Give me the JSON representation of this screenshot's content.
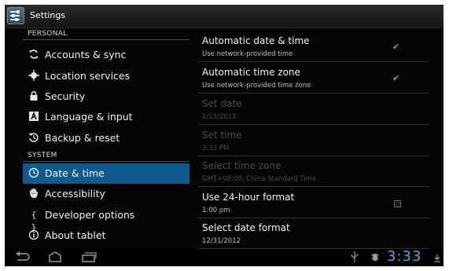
{
  "app": {
    "title": "Settings",
    "accent": "#33b5e5",
    "selected_bg": "#0f5b8f"
  },
  "left": {
    "personal_header": "PERSONAL",
    "system_header": "SYSTEM",
    "items": [
      {
        "label": "Accounts & sync",
        "icon": "sync-icon"
      },
      {
        "label": "Location services",
        "icon": "location-icon"
      },
      {
        "label": "Security",
        "icon": "lock-icon"
      },
      {
        "label": "Language & input",
        "icon": "keyboard-a-icon"
      },
      {
        "label": "Backup & reset",
        "icon": "backup-icon"
      },
      {
        "label": "Date & time",
        "icon": "clock-icon",
        "selected": true
      },
      {
        "label": "Accessibility",
        "icon": "hand-icon"
      },
      {
        "label": "Developer options",
        "icon": "braces-icon"
      },
      {
        "label": "About tablet",
        "icon": "info-icon"
      }
    ]
  },
  "right": {
    "items": [
      {
        "title": "Automatic date & time",
        "summary": "Use network-provided time",
        "checked": true,
        "enabled": true
      },
      {
        "title": "Automatic time zone",
        "summary": "Use network-provided time zone",
        "checked": true,
        "enabled": true
      },
      {
        "title": "Set date",
        "summary": "2/13/2012",
        "enabled": false
      },
      {
        "title": "Set time",
        "summary": "3:33 PM",
        "enabled": false
      },
      {
        "title": "Select time zone",
        "summary": "GMT+08:00, China Standard Time",
        "enabled": false
      },
      {
        "title": "Use 24-hour format",
        "summary": "1:00 pm",
        "checked": false,
        "enabled": true
      },
      {
        "title": "Select date format",
        "summary": "12/31/2012",
        "enabled": true
      }
    ]
  },
  "status": {
    "time": "3:33"
  }
}
